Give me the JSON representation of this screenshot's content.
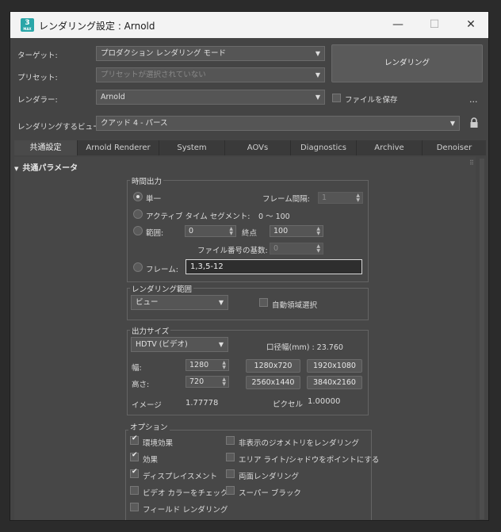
{
  "window": {
    "icon_text": "3",
    "icon_sub": "MAX",
    "title": "レンダリング設定 : Arnold",
    "minimize": "—",
    "maximize": "☐",
    "close": "✕"
  },
  "top": {
    "target_label": "ターゲット:",
    "target_value": "プロダクション レンダリング モード",
    "preset_label": "プリセット:",
    "preset_value": "プリセットが選択されていない",
    "renderer_label": "レンダラー:",
    "renderer_value": "Arnold",
    "save_file_label": "ファイルを保存",
    "save_file_checked": false,
    "more": "...",
    "view_label": "レンダリングするビュー:",
    "view_value": "クアッド 4 - パース",
    "render_button": "レンダリング"
  },
  "tabs": [
    "共通設定",
    "Arnold Renderer",
    "System",
    "AOVs",
    "Diagnostics",
    "Archive",
    "Denoiser"
  ],
  "active_tab": 0,
  "rollout": {
    "title": "共通パラメータ",
    "collapse_glyph": "▼"
  },
  "time_output": {
    "title": "時間出力",
    "single": "単一",
    "frame_interval_label": "フレーム間隔:",
    "frame_interval_value": "1",
    "active_segment": "アクティブ タイム セグメント:",
    "active_segment_value": "0 〜 100",
    "range": "範囲:",
    "range_start": "0",
    "end_label": "終点",
    "range_end": "100",
    "file_number_label": "ファイル番号の基数:",
    "file_number_value": "0",
    "frames": "フレーム:",
    "frames_value": "1,3,5-12",
    "selected": "single"
  },
  "render_area": {
    "title": "レンダリング範囲",
    "value": "ビュー",
    "auto_region": "自動領域選択",
    "auto_region_checked": false
  },
  "output_size": {
    "title": "出力サイズ",
    "preset": "HDTV (ビデオ)",
    "aperture": "口径幅(mm) : 23.760",
    "width_label": "幅:",
    "width_value": "1280",
    "height_label": "高さ:",
    "height_value": "720",
    "presets": [
      "1280x720",
      "1920x1080",
      "2560x1440",
      "3840x2160"
    ],
    "image_label": "イメージ",
    "image_value": "1.77778",
    "pixel_label": "ピクセル",
    "pixel_value": "1.00000"
  },
  "options": {
    "title": "オプション",
    "items": [
      {
        "label": "環境効果",
        "checked": true
      },
      {
        "label": "非表示のジオメトリをレンダリング",
        "checked": false
      },
      {
        "label": "効果",
        "checked": true
      },
      {
        "label": "エリア ライト/シャドウをポイントにする",
        "checked": false
      },
      {
        "label": "ディスプレイスメント",
        "checked": true
      },
      {
        "label": "両面レンダリング",
        "checked": false
      },
      {
        "label": "ビデオ カラーをチェック",
        "checked": false
      },
      {
        "label": "スーパー ブラック",
        "checked": false
      },
      {
        "label": "フィールド レンダリング",
        "checked": false
      }
    ]
  }
}
